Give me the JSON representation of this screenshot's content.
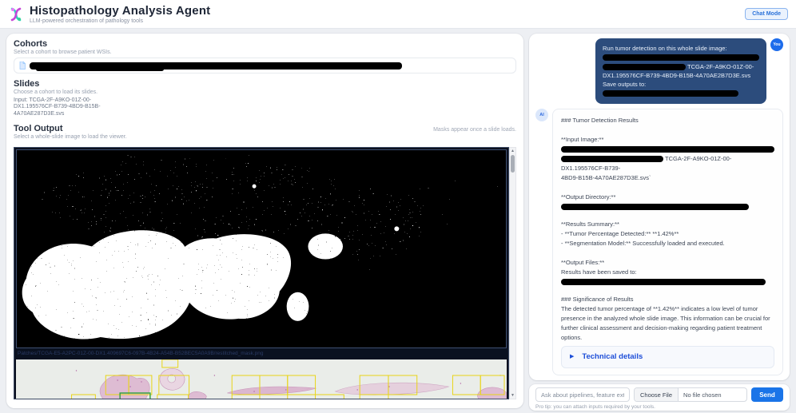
{
  "header": {
    "title": "Histopathology Analysis Agent",
    "subtitle": "LLM-powered orchestration of pathology tools",
    "chat_mode_button": "Chat Mode"
  },
  "left_panel": {
    "cohorts_heading": "Cohorts",
    "cohorts_desc": "Select a cohort to browse patient WSIs.",
    "slides_heading": "Slides",
    "slides_desc": "Choose a cohort to load its slides.",
    "slides_input": "Input: TCGA-2F-A9KO-01Z-00-DX1.195576CF-B739-4BD9-B15B-4A70AE287D3E.svs",
    "tool_output_heading": "Tool Output",
    "tool_output_hint": "Masks appear once a slide loads.",
    "tool_output_desc": "Select a whole-slide image to load the viewer.",
    "mask_caption": "Patches/TCGA-E5-A2PC-01Z-00-DX1.409697C6-097B-4B24-A54B-B52BEC5A0A9B/restitched_mask.png"
  },
  "chat": {
    "user": {
      "avatar": "You",
      "line1": "Run tumor detection on this whole slide image:",
      "file_and_instruction": "TCGA-2F-A9KO-01Z-00-DX1.195576CF-B739-4BD9-B15B-4A70AE2B7D3E.svs Save outputs to:"
    },
    "ai": {
      "avatar": "AI",
      "heading1": "### Tumor Detection Results",
      "input_image_label": "**Input Image:**",
      "input_image_file_1": "TCGA-2F-A9KO-01Z-00-DX1.195576CF-B739-",
      "input_image_file_2": "4BD9-B15B-4A70AE287D3E.svs`",
      "output_dir_label": "**Output Directory:**",
      "results_summary_label": "**Results Summary:**",
      "result_line_1": "- **Tumor Percentage Detected:** **1.42%**",
      "result_line_2": "- **Segmentation Model:** Successfully loaded and executed.",
      "output_files_label": "**Output Files:**",
      "output_files_text": "Results have been saved to:",
      "heading2": "### Significance of Results",
      "significance_text": "The detected tumor percentage of **1.42%** indicates a low level of tumor presence in the analyzed whole slide image. This information can be crucial for further clinical assessment and decision-making regarding patient treatment options.",
      "technical_details_label": "Technical details"
    }
  },
  "composer": {
    "input_placeholder": "Ask about pipelines, feature extracti",
    "choose_file_label": "Choose File",
    "no_file_text": "No file chosen",
    "send_label": "Send",
    "pro_tip": "Pro tip: you can attach inputs required by your tools."
  },
  "icons": {
    "scroll_up": "▲",
    "scroll_down": "▼",
    "details_arrow": "▶"
  },
  "colors": {
    "accent_blue": "#1a74e8",
    "user_bubble": "#2c4c7c",
    "mask_bg": "#000000",
    "patch_box_yellow": "#e8d416",
    "patch_box_green": "#2da13a"
  }
}
